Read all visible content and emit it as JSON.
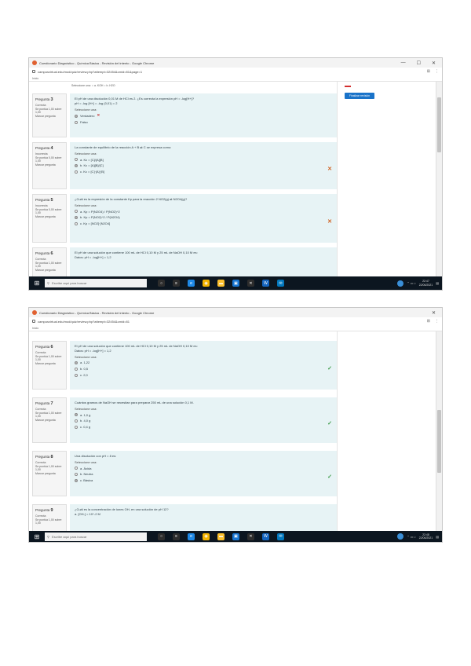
{
  "screenshot_1": {
    "window_title": "Cuestionario Diagnóstico - Química Básica - Revisión del intento - Google Chrome",
    "url": "campusvirtual.edu/mod/quiz/review.php?attempt=32454&cmid=81&page=1",
    "bookmark": "Inicio",
    "window_controls": {
      "minimize": "—",
      "maximize": "☐",
      "close": "✕"
    },
    "prev_question_tail": "Seleccione una: ○ a. KOH  ○ b. H2O",
    "nav_button": "Finalizar revisión",
    "questions": [
      {
        "number": "3",
        "status": "Correcta",
        "score": "Se puntúa 1,00 sobre 1,00",
        "flag": "Marcar pregunta",
        "text": "El pH de una disolución 0,01 M de HCl es 2. ¿Es correcta la expresión pH = -log[H+]?",
        "formula": "pH = -log [H+] = -log (0,01) = 2",
        "prompt": "Seleccione una:",
        "options": [
          {
            "label": "Verdadero",
            "selected": true,
            "mark": "✕"
          },
          {
            "label": "Falso",
            "selected": false,
            "mark": ""
          }
        ],
        "result": ""
      },
      {
        "number": "4",
        "status": "Incorrecta",
        "score": "Se puntúa 0,00 sobre 1,00",
        "flag": "Marcar pregunta",
        "text": "La constante de equilibrio de la reacción A + B ⇌ C se expresa como:",
        "formula": "",
        "prompt": "Seleccione una:",
        "options": [
          {
            "label": "a. Kc = [C]/[A][B]",
            "selected": false,
            "mark": ""
          },
          {
            "label": "b. Kc = [A][B]/[C]",
            "selected": true,
            "mark": ""
          },
          {
            "label": "c. Kc = [C]·[A]·[B]",
            "selected": false,
            "mark": ""
          }
        ],
        "result": "✕"
      },
      {
        "number": "5",
        "status": "Incorrecta",
        "score": "Se puntúa 0,00 sobre 1,00",
        "flag": "Marcar pregunta",
        "text": "¿Cuál es la expresión de la constante Kp para la reacción 2 NO2(g) ⇌ N2O4(g)?",
        "formula": "",
        "prompt": "Seleccione una:",
        "options": [
          {
            "label": "a. Kp = P(N2O4) / P(NO2)^2",
            "selected": false,
            "mark": ""
          },
          {
            "label": "b. Kp = P(NO2)^2 / P(N2O4)",
            "selected": true,
            "mark": ""
          },
          {
            "label": "c. Kp = [NO2]·[N2O4]",
            "selected": false,
            "mark": ""
          }
        ],
        "result": "✕"
      },
      {
        "number": "6",
        "status": "Correcta",
        "score": "Se puntúa 1,00 sobre 1,00",
        "flag": "Marcar pregunta",
        "text": "El pH de una solución que contiene 100 mL de HCl 0,10 M y 25 mL de NaOH 0,10 M es:",
        "formula": "Datos: pH = -log[H+] = 1,2",
        "prompt": "",
        "options": [],
        "result": ""
      }
    ],
    "taskbar": {
      "search_placeholder": "Escribe aquí para buscar",
      "time": "22:47",
      "date": "22/06/2021"
    }
  },
  "screenshot_2": {
    "window_title": "Cuestionario Diagnóstico - Química Básica - Revisión del intento - Google Chrome",
    "url": "campusvirtual.edu/mod/quiz/review.php?attempt=32454&cmid=81",
    "bookmark": "Inicio",
    "window_controls": {
      "close": "✕"
    },
    "questions": [
      {
        "number": "6",
        "status": "Correcta",
        "score": "Se puntúa 1,00 sobre 1,00",
        "flag": "Marcar pregunta",
        "text": "El pH de una solución que contiene 100 mL de HCl 0,10 M y 25 mL de NaOH 0,10 M es:",
        "formula": "Datos: pH = -log[H+] = 1,2",
        "prompt": "Seleccione una:",
        "options": [
          {
            "label": "a. 1,22",
            "selected": true,
            "mark": ""
          },
          {
            "label": "b. 0,5",
            "selected": false,
            "mark": ""
          },
          {
            "label": "c. 2,0",
            "selected": false,
            "mark": ""
          }
        ],
        "result": "✓"
      },
      {
        "number": "7",
        "status": "Correcta",
        "score": "Se puntúa 1,00 sobre 1,00",
        "flag": "Marcar pregunta",
        "text": "Cuántos gramos de NaOH se necesitan para preparar 250 mL de una solución 0,1 M.",
        "formula": "",
        "prompt": "Seleccione una:",
        "options": [
          {
            "label": "a. 1,0 g",
            "selected": true,
            "mark": ""
          },
          {
            "label": "b. 4,0 g",
            "selected": false,
            "mark": ""
          },
          {
            "label": "c. 0,4 g",
            "selected": false,
            "mark": ""
          }
        ],
        "result": "✓"
      },
      {
        "number": "8",
        "status": "Correcta",
        "score": "Se puntúa 1,00 sobre 1,00",
        "flag": "Marcar pregunta",
        "text": "Una disolución con pH = 8 es:",
        "formula": "",
        "prompt": "Seleccione una:",
        "options": [
          {
            "label": "a. Ácida",
            "selected": false,
            "mark": ""
          },
          {
            "label": "b. Neutra",
            "selected": false,
            "mark": ""
          },
          {
            "label": "c. Básica",
            "selected": true,
            "mark": ""
          }
        ],
        "result": "✓"
      },
      {
        "number": "9",
        "status": "Correcta",
        "score": "Se puntúa 1,00 sobre 1,00",
        "flag": "Marcar pregunta",
        "text": "¿Cuál es la concentración de iones OH- en una solución de pH 12?",
        "formula": "a. [OH-] = 10^-2 M",
        "prompt": "",
        "options": [],
        "result": ""
      }
    ],
    "taskbar": {
      "search_placeholder": "Escribe aquí para buscar",
      "time": "22:48",
      "date": "22/06/2021"
    }
  },
  "colors": {
    "question_bg": "#e7f3f5",
    "correct": "#3d9a48",
    "incorrect": "#c62828",
    "nav_button": "#1a73c9",
    "taskbar": "#0c1620"
  }
}
